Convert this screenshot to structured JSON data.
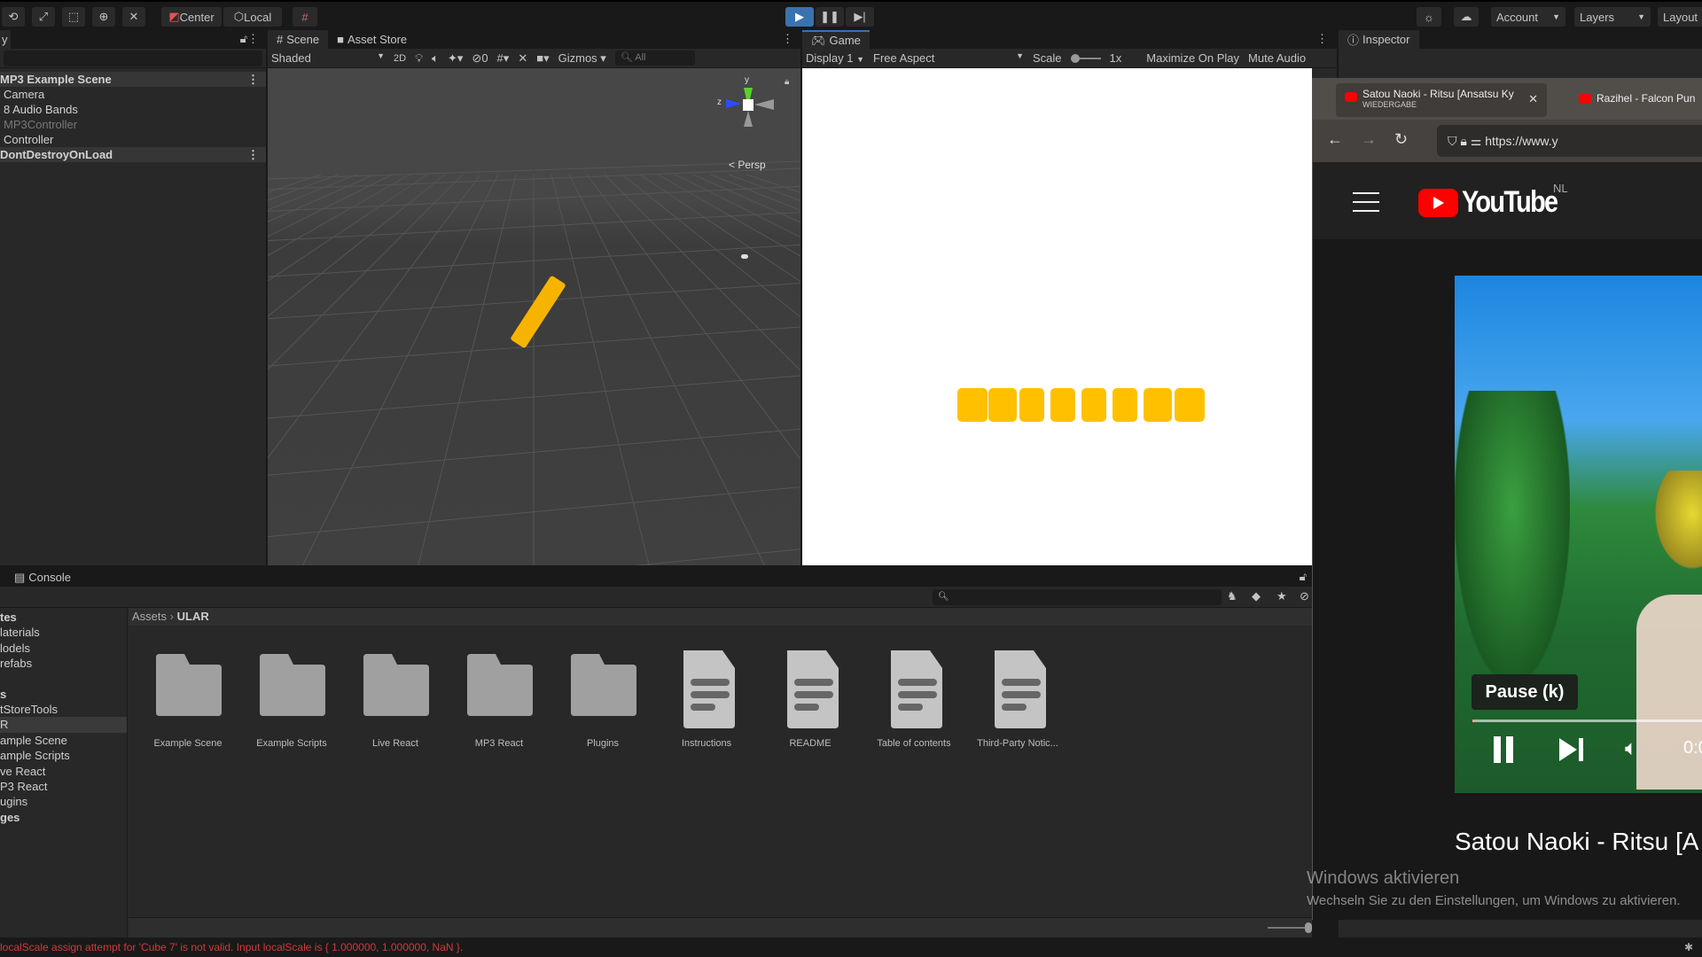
{
  "toolbar": {
    "pivot_center": "Center",
    "pivot_local": "Local",
    "play_icon": "play-icon",
    "pause_icon": "pause-icon",
    "step_icon": "step-icon",
    "account": "Account",
    "layers": "Layers",
    "layout": "Layout"
  },
  "hierarchy": {
    "tab": "y",
    "items": [
      {
        "label": "MP3 Example Scene",
        "kind": "scene"
      },
      {
        "label": "Camera"
      },
      {
        "label": "8 Audio Bands"
      },
      {
        "label": "MP3Controller",
        "disabled": true
      },
      {
        "label": "Controller"
      },
      {
        "label": "DontDestroyOnLoad",
        "kind": "scene"
      }
    ]
  },
  "scene": {
    "tabs": [
      "Scene",
      "Asset Store"
    ],
    "shading": "Shaded",
    "mode_2d": "2D",
    "hidden_count": "0",
    "gizmos": "Gizmos",
    "search_placeholder": "All",
    "persp": "< Persp",
    "axis_y": "y",
    "axis_z": "z"
  },
  "game": {
    "tab": "Game",
    "display": "Display 1",
    "aspect": "Free Aspect",
    "scale_label": "Scale",
    "scale_value": "1x",
    "maximize": "Maximize On Play",
    "mute": "Mute Audio",
    "cube_color": "#ffc000",
    "cube_count": 8
  },
  "inspector": {
    "tab": "Inspector"
  },
  "console": {
    "tab": "Console"
  },
  "project": {
    "tree": [
      {
        "label": "tes",
        "bold": true
      },
      {
        "label": "laterials"
      },
      {
        "label": "lodels"
      },
      {
        "label": "refabs"
      },
      {
        "label": "s",
        "bold": true
      },
      {
        "label": "tStoreTools"
      },
      {
        "label": "R",
        "selected": true
      },
      {
        "label": "ample Scene"
      },
      {
        "label": "ample Scripts"
      },
      {
        "label": "ve React"
      },
      {
        "label": "P3 React"
      },
      {
        "label": "ugins"
      },
      {
        "label": "ges",
        "bold": true
      }
    ],
    "breadcrumb": [
      "Assets",
      "ULAR"
    ],
    "assets": [
      {
        "name": "Example Scene",
        "type": "folder"
      },
      {
        "name": "Example Scripts",
        "type": "folder"
      },
      {
        "name": "Live React",
        "type": "folder"
      },
      {
        "name": "MP3 React",
        "type": "folder"
      },
      {
        "name": "Plugins",
        "type": "folder"
      },
      {
        "name": "Instructions",
        "type": "doc"
      },
      {
        "name": "README",
        "type": "doc"
      },
      {
        "name": "Table of contents",
        "type": "doc"
      },
      {
        "name": "Third-Party Notic...",
        "type": "doc"
      }
    ]
  },
  "status": {
    "error": "localScale assign attempt for 'Cube 7' is not valid. Input localScale is { 1.000000, 1.000000, NaN }.",
    "color": "#d03a3a"
  },
  "browser": {
    "tabs": [
      {
        "title": "Satou Naoki - Ritsu [Ansatsu Ky",
        "sub": "WIEDERGABE"
      },
      {
        "title": "Razihel - Falcon Pun"
      }
    ],
    "url": "https://www.y",
    "youtube": {
      "logo": "YouTube",
      "region": "NL",
      "tooltip": "Pause (k)",
      "time": "0:0",
      "video_title": "Satou Naoki - Ritsu [A",
      "accent": "#ff0000",
      "progress_percent": 0.5
    }
  },
  "windows": {
    "title": "Windows aktivieren",
    "subtitle": "Wechseln Sie zu den Einstellungen, um Windows zu aktivieren."
  }
}
